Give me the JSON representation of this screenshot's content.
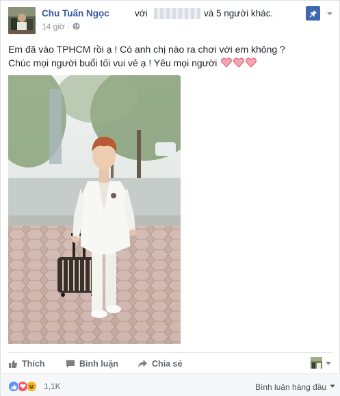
{
  "post": {
    "author": "Chu Tuấn Ngọc",
    "with_label": "với",
    "tagged_others": "và 5 người khác.",
    "timestamp": "14 giờ ·",
    "text_line_1": "Em đã vào TPHCM rồi ạ ! Có anh chị nào ra chơi với em không ?",
    "text_line_2": "Chúc mọi người buổi tối vui vẻ ạ ! Yêu mọi người"
  },
  "actions": {
    "like_label": "Thích",
    "comment_label": "Bình luận",
    "share_label": "Chia sẻ"
  },
  "reactions": {
    "count": "1,1K",
    "sort_label": "Bình luận hàng đầu"
  },
  "icons": {
    "privacy": "globe-icon",
    "pin": "pin-icon",
    "menu": "chevron-down-icon",
    "like": "thumbs-up-icon",
    "comment": "speech-bubble-icon",
    "share": "share-arrow-icon",
    "heart": "heart-emoji-icon"
  },
  "colors": {
    "author_link": "#365899",
    "meta_text": "#90949c",
    "action_text": "#616770",
    "pin_button": "#4267b2",
    "like_reaction": "#5890ff",
    "love_reaction": "#f25268",
    "haha_reaction": "#f7b125",
    "footer_bg": "#f6f7f9"
  }
}
